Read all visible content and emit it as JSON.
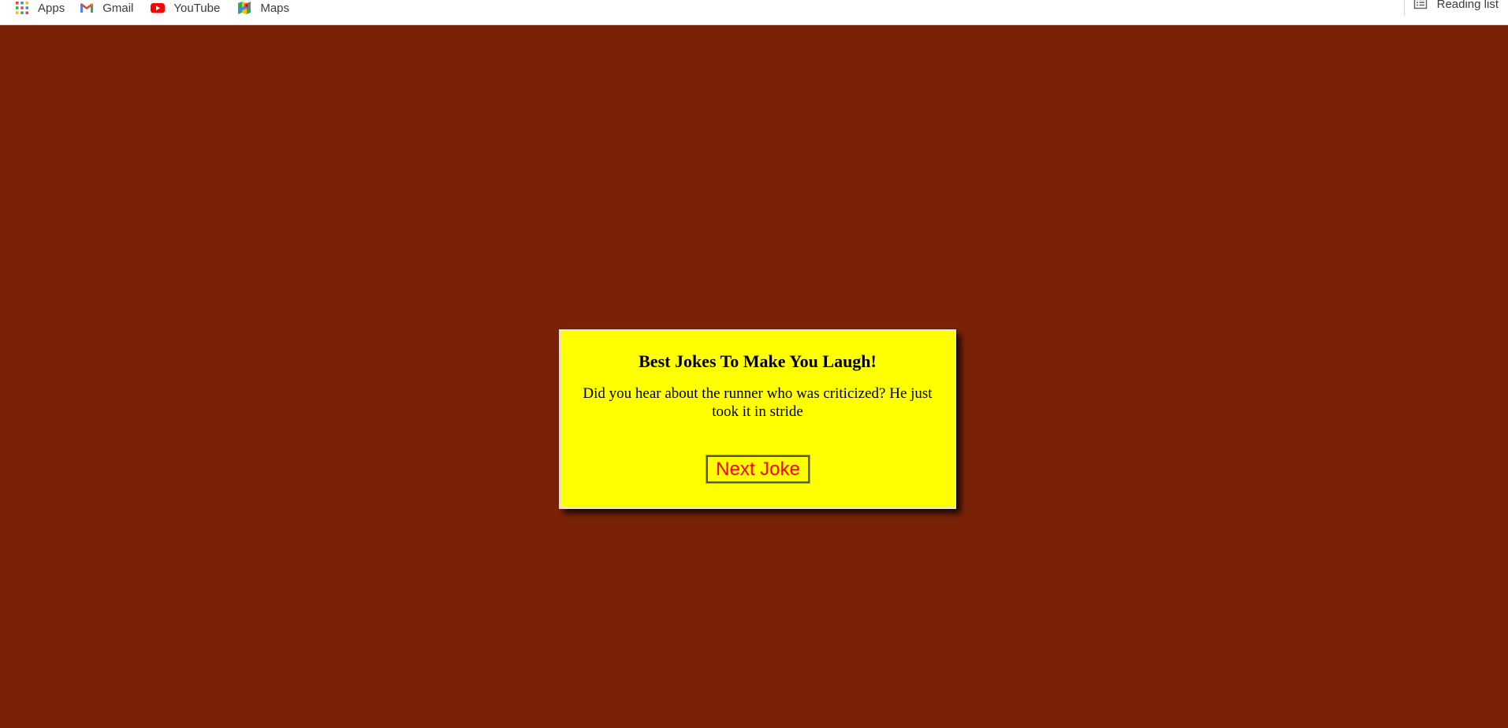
{
  "bookmarks_bar": {
    "items": [
      {
        "label": "Apps",
        "icon": "apps-grid-icon"
      },
      {
        "label": "Gmail",
        "icon": "gmail-icon"
      },
      {
        "label": "YouTube",
        "icon": "youtube-icon"
      },
      {
        "label": "Maps",
        "icon": "maps-icon"
      }
    ],
    "reading_list": {
      "label": "Reading list",
      "icon": "reading-list-icon"
    }
  },
  "card": {
    "title": "Best Jokes To Make You Laugh!",
    "joke": "Did you hear about the runner who was criticized? He just took it in stride",
    "button_label": "Next Joke"
  },
  "colors": {
    "page_background": "#7a2208",
    "card_background": "#ffff00",
    "button_text": "#ff0000"
  }
}
